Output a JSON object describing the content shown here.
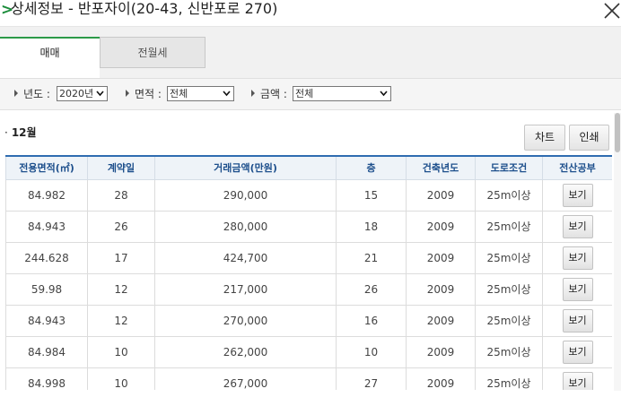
{
  "header": {
    "arrow": ">",
    "title": "상세정보 - 반포자이(20-43, 신반포로 270)"
  },
  "tabs": [
    {
      "label": "매매"
    },
    {
      "label": "전월세"
    }
  ],
  "filters": {
    "year": {
      "label": "년도 :",
      "value": "2020년"
    },
    "area": {
      "label": "면적 :",
      "value": "전체"
    },
    "price": {
      "label": "금액 :",
      "value": "전체"
    }
  },
  "section": {
    "bullet": "·",
    "month": "12월",
    "chart_button": "차트",
    "print_button": "인쇄"
  },
  "table": {
    "columns": [
      "전용면적(㎡)",
      "계약일",
      "거래금액(만원)",
      "층",
      "건축년도",
      "도로조건",
      "전산공부"
    ],
    "view_label": "보기",
    "rows": [
      [
        "84.982",
        "28",
        "290,000",
        "15",
        "2009",
        "25m이상"
      ],
      [
        "84.943",
        "26",
        "280,000",
        "18",
        "2009",
        "25m이상"
      ],
      [
        "244.628",
        "17",
        "424,700",
        "21",
        "2009",
        "25m이상"
      ],
      [
        "59.98",
        "12",
        "217,000",
        "26",
        "2009",
        "25m이상"
      ],
      [
        "84.943",
        "12",
        "270,000",
        "16",
        "2009",
        "25m이상"
      ],
      [
        "84.984",
        "10",
        "262,000",
        "10",
        "2009",
        "25m이상"
      ],
      [
        "84.998",
        "10",
        "267,000",
        "27",
        "2009",
        "25m이상"
      ]
    ]
  },
  "colors": {
    "accent": "#2c9a48",
    "header_text": "#1d4f8c",
    "header_border": "#2f6cb0"
  }
}
